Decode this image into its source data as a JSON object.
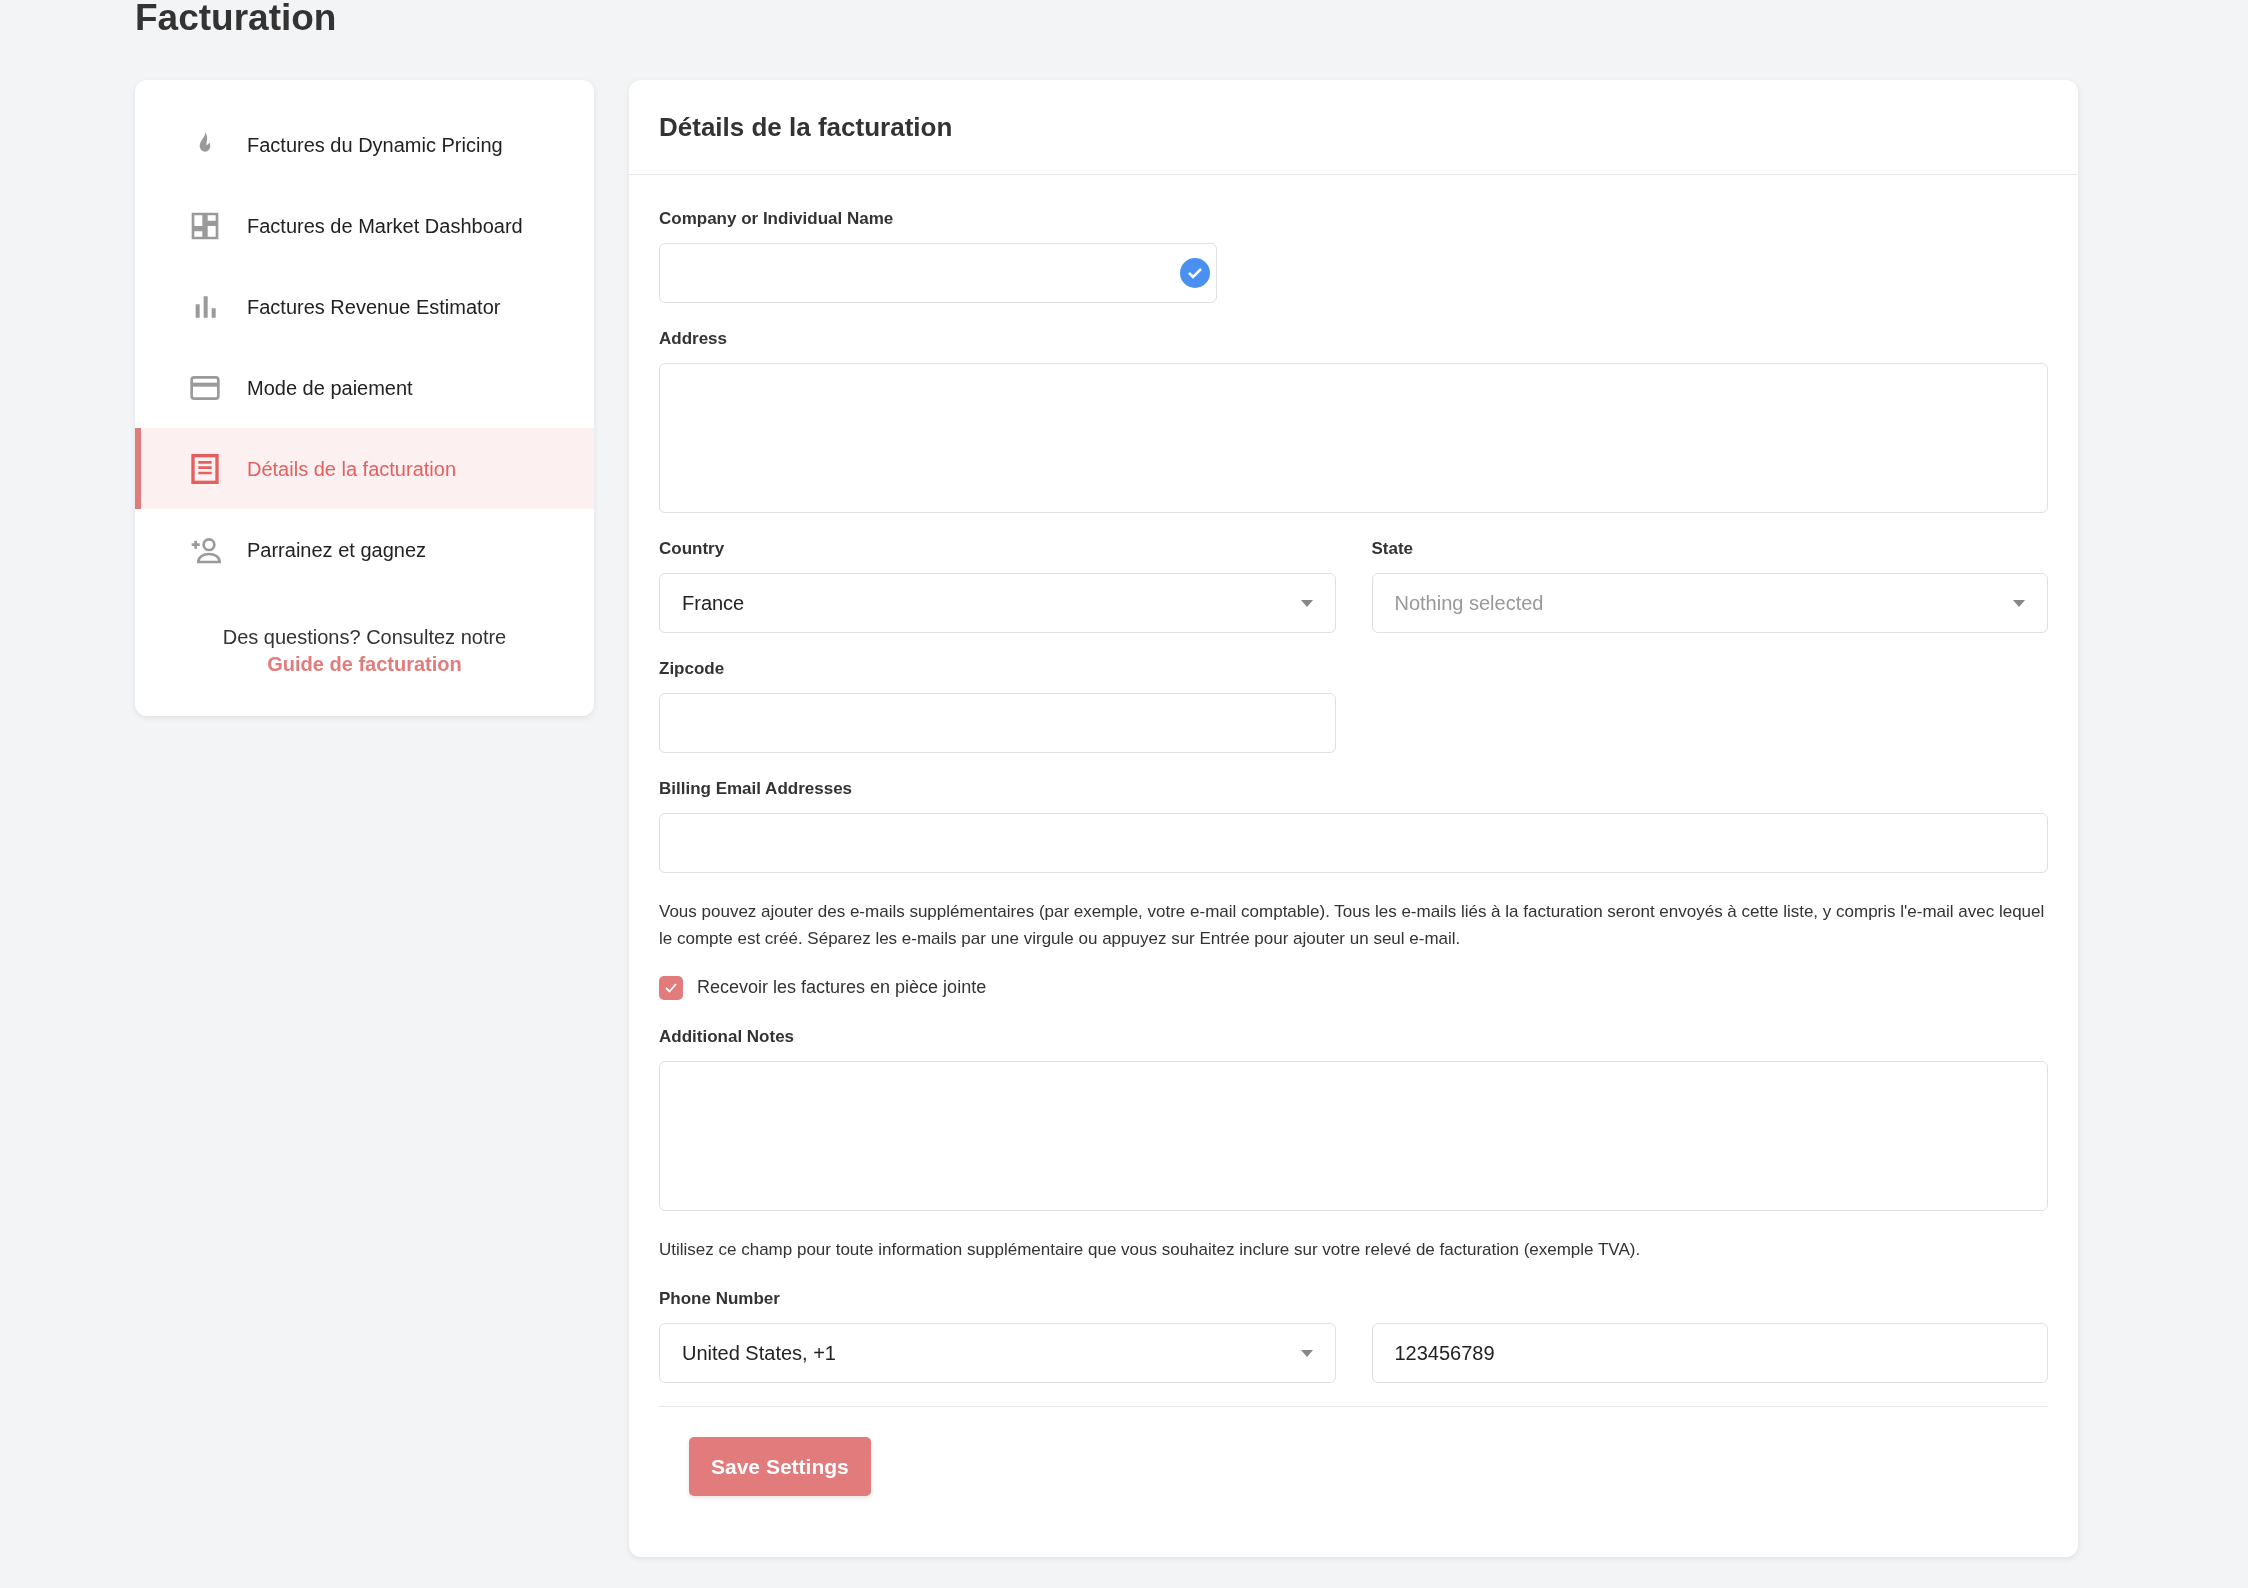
{
  "page_title": "Facturation",
  "sidebar": {
    "items": [
      {
        "label": "Factures du Dynamic Pricing",
        "selected": false
      },
      {
        "label": "Factures de Market Dashboard",
        "selected": false
      },
      {
        "label": "Factures Revenue Estimator",
        "selected": false
      },
      {
        "label": "Mode de paiement",
        "selected": false
      },
      {
        "label": "Détails de la facturation",
        "selected": true
      },
      {
        "label": "Parrainez et gagnez",
        "selected": false
      }
    ],
    "help": {
      "text": "Des questions? Consultez notre",
      "link": "Guide de facturation"
    }
  },
  "panel": {
    "title": "Détails de la facturation",
    "fields": [
      {
        "kind": "name",
        "label": "Company or Individual Name",
        "verified": true
      },
      {
        "kind": "textarea",
        "label": "Address"
      },
      {
        "kind": "pair",
        "fields": [
          {
            "kind": "select",
            "label": "Country",
            "value": "France"
          },
          {
            "kind": "select",
            "label": "State",
            "placeholder": "Nothing selected"
          }
        ]
      },
      {
        "kind": "short",
        "label": "Zipcode"
      },
      {
        "kind": "text",
        "label": "Billing Email Addresses",
        "help": "Vous pouvez ajouter des e-mails supplémentaires (par exemple, votre e-mail comptable). Tous les e-mails liés à la facturation seront envoyés à cette liste, y compris l'e-mail avec lequel le compte est créé. Séparez les e-mails par une virgule ou appuyez sur Entrée pour ajouter un seul e-mail."
      },
      {
        "kind": "checkbox",
        "label": "Recevoir les factures en pièce jointe",
        "checked": true
      },
      {
        "kind": "textarea",
        "label": "Additional Notes",
        "help": "Utilisez ce champ pour toute information supplémentaire que vous souhaitez inclure sur votre relevé de facturation (exemple TVA)."
      },
      {
        "kind": "phone",
        "label": "Phone Number",
        "code": "United States, +1",
        "value": "123456789"
      }
    ],
    "save_button": "Save Settings"
  }
}
